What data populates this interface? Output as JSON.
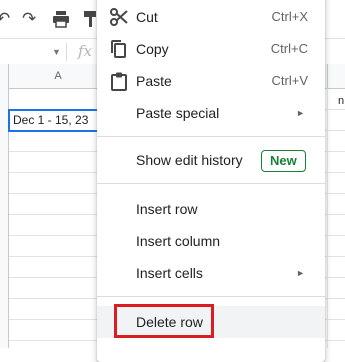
{
  "sheet": {
    "column_header": "A",
    "selected_cell_value": "Dec 1 - 15, 23",
    "right_edge_fragment": "n"
  },
  "toolbar": {
    "icons": [
      "undo-icon",
      "redo-icon",
      "print-icon",
      "paint-format-icon"
    ]
  },
  "formula_bar": {
    "fx_label": "fx"
  },
  "context_menu": {
    "cut": {
      "label": "Cut",
      "shortcut": "Ctrl+X",
      "icon": "scissors-icon"
    },
    "copy": {
      "label": "Copy",
      "shortcut": "Ctrl+C",
      "icon": "copy-icon"
    },
    "paste": {
      "label": "Paste",
      "shortcut": "Ctrl+V",
      "icon": "clipboard-icon"
    },
    "paste_special": {
      "label": "Paste special",
      "arrow": "►"
    },
    "show_edit_history": {
      "label": "Show edit history",
      "badge": "New"
    },
    "insert_row": {
      "label": "Insert row"
    },
    "insert_column": {
      "label": "Insert column"
    },
    "insert_cells": {
      "label": "Insert cells",
      "arrow": "►"
    },
    "delete_row": {
      "label": "Delete row"
    }
  },
  "colors": {
    "selection_blue": "#1a73e8",
    "badge_green": "#188038",
    "highlight_red": "#d91d23"
  }
}
